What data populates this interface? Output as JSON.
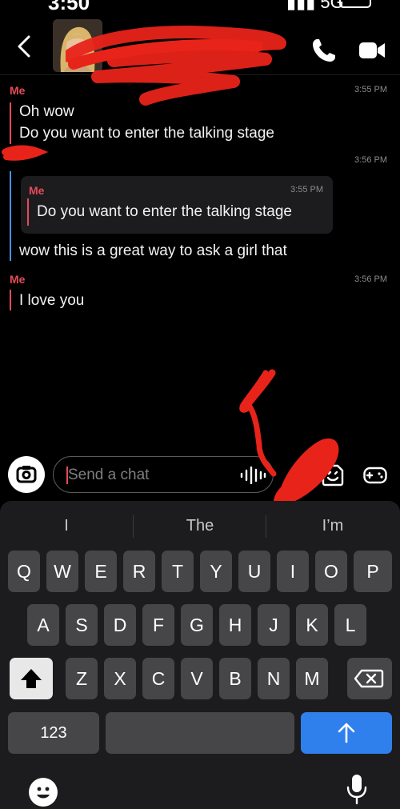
{
  "status_bar": {
    "time": "3:50"
  },
  "header": {
    "contact_name": "",
    "icons": [
      "back-chevron-icon",
      "phone-icon",
      "video-camera-icon"
    ]
  },
  "messages": [
    {
      "sender": "Me",
      "time": "3:55 PM",
      "lines": [
        "Oh wow",
        "Do you want to enter the talking stage"
      ],
      "bar_color": "#e64a5a"
    },
    {
      "sender": "",
      "time": "3:56 PM",
      "reply_to": {
        "sender": "Me",
        "time": "3:55 PM",
        "text": "Do you want to enter the talking stage"
      },
      "lines": [
        "wow this is a great way to ask a girl that"
      ],
      "bar_color": "#4a90e2"
    },
    {
      "sender": "Me",
      "time": "3:56 PM",
      "lines": [
        "I love you"
      ],
      "bar_color": "#e64a5a"
    }
  ],
  "composer": {
    "placeholder": "Send a chat",
    "icons": [
      "camera-icon",
      "voice-wave-icon",
      "sticker-icon",
      "game-controller-icon"
    ]
  },
  "keyboard": {
    "suggestions": [
      "I",
      "The",
      "I’m"
    ],
    "rows": [
      [
        "Q",
        "W",
        "E",
        "R",
        "T",
        "Y",
        "U",
        "I",
        "O",
        "P"
      ],
      [
        "A",
        "S",
        "D",
        "F",
        "G",
        "H",
        "J",
        "K",
        "L"
      ],
      [
        "Z",
        "X",
        "C",
        "V",
        "B",
        "N",
        "M"
      ]
    ],
    "numbers_label": "123"
  },
  "colors": {
    "sender_red": "#e64a5a",
    "friend_blue": "#4a90e2",
    "return_blue": "#2f80ed",
    "redaction_red": "#e8231a"
  }
}
